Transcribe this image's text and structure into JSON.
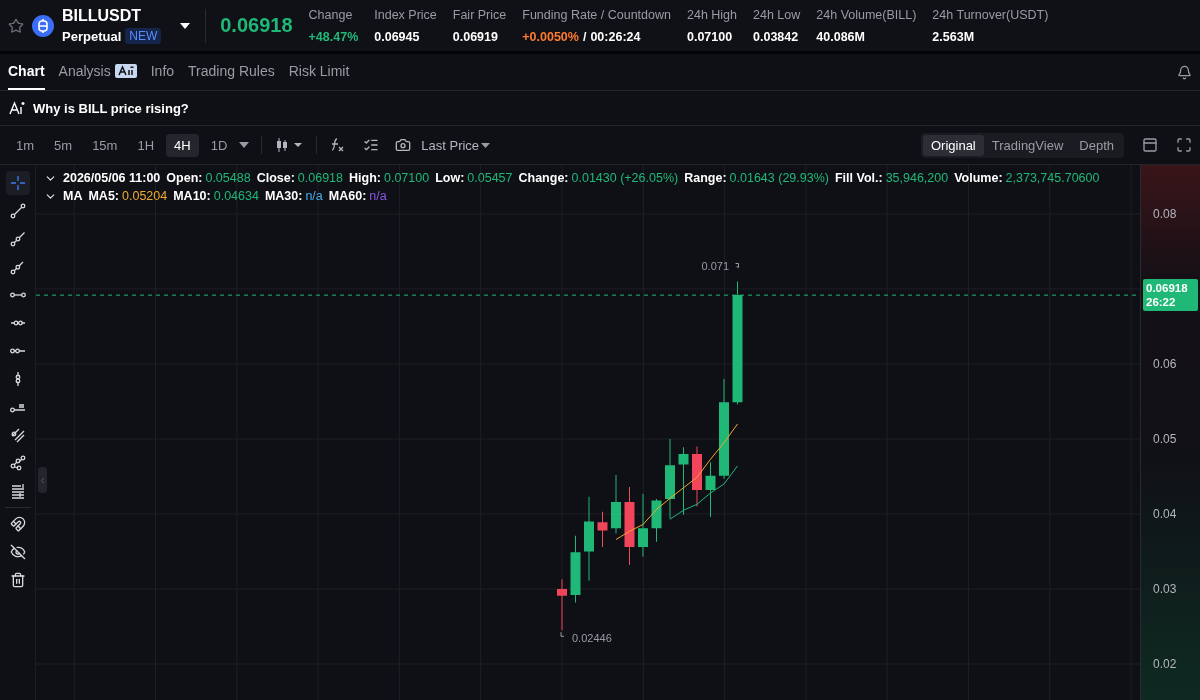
{
  "header": {
    "symbol": "BILLUSDT",
    "contract_type": "Perpetual",
    "badge": "NEW",
    "favorite": false,
    "last_price": "0.06918",
    "stats": [
      {
        "label": "Change",
        "values": [
          {
            "text": "+48.47%",
            "color": "#1fb877"
          }
        ]
      },
      {
        "label": "Index Price",
        "values": [
          {
            "text": "0.06945",
            "color": "#ffffff"
          }
        ]
      },
      {
        "label": "Fair Price",
        "values": [
          {
            "text": "0.06919",
            "color": "#ffffff"
          }
        ]
      },
      {
        "label": "Funding Rate / Countdown",
        "values": [
          {
            "text": "+0.0050%",
            "color": "#ff7a2f"
          },
          {
            "text": "/",
            "color": "#ffffff"
          },
          {
            "text": "00:26:24",
            "color": "#ffffff"
          }
        ]
      },
      {
        "label": "24h High",
        "values": [
          {
            "text": "0.07100",
            "color": "#ffffff"
          }
        ]
      },
      {
        "label": "24h Low",
        "values": [
          {
            "text": "0.03842",
            "color": "#ffffff"
          }
        ]
      },
      {
        "label": "24h Volume(BILL)",
        "values": [
          {
            "text": "40.086M",
            "color": "#ffffff"
          }
        ]
      },
      {
        "label": "24h Turnover(USDT)",
        "values": [
          {
            "text": "2.563M",
            "color": "#ffffff"
          }
        ]
      }
    ]
  },
  "tabs": [
    {
      "label": "Chart",
      "selected": true,
      "ai_badge": false
    },
    {
      "label": "Analysis",
      "selected": false,
      "ai_badge": true
    },
    {
      "label": "Info",
      "selected": false,
      "ai_badge": false
    },
    {
      "label": "Trading Rules",
      "selected": false,
      "ai_badge": false
    },
    {
      "label": "Risk Limit",
      "selected": false,
      "ai_badge": false
    }
  ],
  "banner": {
    "text": "Why is BILL price rising?"
  },
  "intervals": [
    {
      "label": "1m",
      "selected": false
    },
    {
      "label": "5m",
      "selected": false
    },
    {
      "label": "15m",
      "selected": false
    },
    {
      "label": "1H",
      "selected": false
    },
    {
      "label": "4H",
      "selected": true
    },
    {
      "label": "1D",
      "selected": false
    }
  ],
  "toolbar": {
    "price_type": "Last Price"
  },
  "views": [
    {
      "label": "Original",
      "selected": true
    },
    {
      "label": "TradingView",
      "selected": false
    },
    {
      "label": "Depth",
      "selected": false
    }
  ],
  "tools": [
    {
      "kind": "crosshair",
      "selected": true
    },
    {
      "kind": "trend",
      "selected": false
    },
    {
      "kind": "ray",
      "selected": false
    },
    {
      "kind": "extended",
      "selected": false
    },
    {
      "kind": "hline",
      "selected": false
    },
    {
      "kind": "hray",
      "selected": false
    },
    {
      "kind": "hsegment",
      "selected": false
    },
    {
      "kind": "vline",
      "selected": false
    },
    {
      "kind": "priceline",
      "selected": false
    },
    {
      "kind": "channel",
      "selected": false
    },
    {
      "kind": "pattern",
      "selected": false
    },
    {
      "kind": "fib",
      "selected": false
    },
    {
      "kind": "magnet",
      "selected": false,
      "divider_before": true
    },
    {
      "kind": "hide",
      "selected": false
    },
    {
      "kind": "trash",
      "selected": false
    }
  ],
  "legend": {
    "date": "2026/05/06 11:00",
    "fields": [
      {
        "label": "Open:",
        "value": "0.05488"
      },
      {
        "label": "Close:",
        "value": "0.06918"
      },
      {
        "label": "High:",
        "value": "0.07100"
      },
      {
        "label": "Low:",
        "value": "0.05457"
      },
      {
        "label": "Change:",
        "value": "0.01430 (+26.05%)"
      },
      {
        "label": "Range:",
        "value": "0.01643 (29.93%)"
      },
      {
        "label": "Fill Vol.:",
        "value": "35,946,200"
      },
      {
        "label": "Volume:",
        "value": "2,373,745.70600"
      }
    ],
    "ma": {
      "label": "MA",
      "lines": [
        {
          "label": "MA5:",
          "value": "0.05204",
          "color": "#f0a92c"
        },
        {
          "label": "MA10:",
          "value": "0.04634",
          "color": "#1fb877"
        },
        {
          "label": "MA30:",
          "value": "n/a",
          "color": "#4aa8e8"
        },
        {
          "label": "MA60:",
          "value": "n/a",
          "color": "#8a55e0"
        }
      ]
    }
  },
  "annotations": {
    "high": "0.071",
    "low": "0.02446"
  },
  "price_tag": {
    "price": "0.06918",
    "countdown": "26:22"
  },
  "price_axis": {
    "upper_labels": [
      "0.08"
    ],
    "lower_labels": [
      "0.06",
      "0.05",
      "0.04",
      "0.03",
      "0.02"
    ]
  }
}
